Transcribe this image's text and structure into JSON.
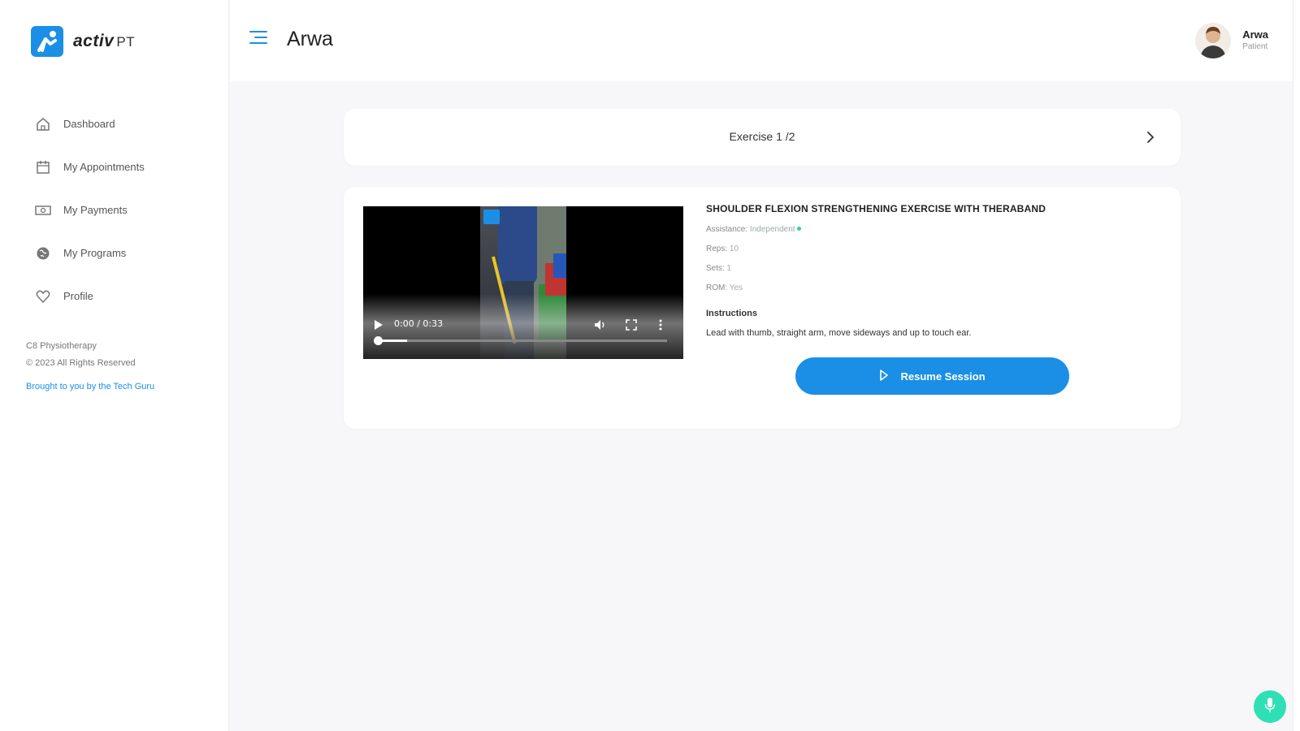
{
  "brand": {
    "name": "activ",
    "suffix": "PT"
  },
  "sidebar": {
    "items": [
      {
        "label": "Dashboard",
        "icon": "home-icon"
      },
      {
        "label": "My Appointments",
        "icon": "calendar-icon"
      },
      {
        "label": "My Payments",
        "icon": "money-icon"
      },
      {
        "label": "My Programs",
        "icon": "globe-icon"
      },
      {
        "label": "Profile",
        "icon": "heart-icon"
      }
    ],
    "footer": {
      "company": "C8 Physiotherapy",
      "copyright": "© 2023 All Rights Reserved",
      "credit": "Brought to you by the Tech Guru"
    }
  },
  "header": {
    "title": "Arwa",
    "user": {
      "name": "Arwa",
      "role": "Patient"
    }
  },
  "exercise": {
    "counter": "Exercise 1 /2",
    "title": "SHOULDER FLEXION STRENGTHENING EXERCISE WITH THERABAND",
    "assistance_label": "Assistance:",
    "assistance_value": "Independent",
    "reps_label": "Reps:",
    "reps_value": "10",
    "sets_label": "Sets:",
    "sets_value": "1",
    "rom_label": "ROM:",
    "rom_value": "Yes",
    "instructions_label": "Instructions",
    "instructions": "Lead with thumb, straight arm, move sideways and up to touch ear.",
    "video": {
      "time": "0:00 / 0:33",
      "progress": 0.1
    },
    "resume_label": "Resume Session"
  },
  "colors": {
    "accent": "#1b8fe6",
    "fab": "#2fe0b4"
  }
}
